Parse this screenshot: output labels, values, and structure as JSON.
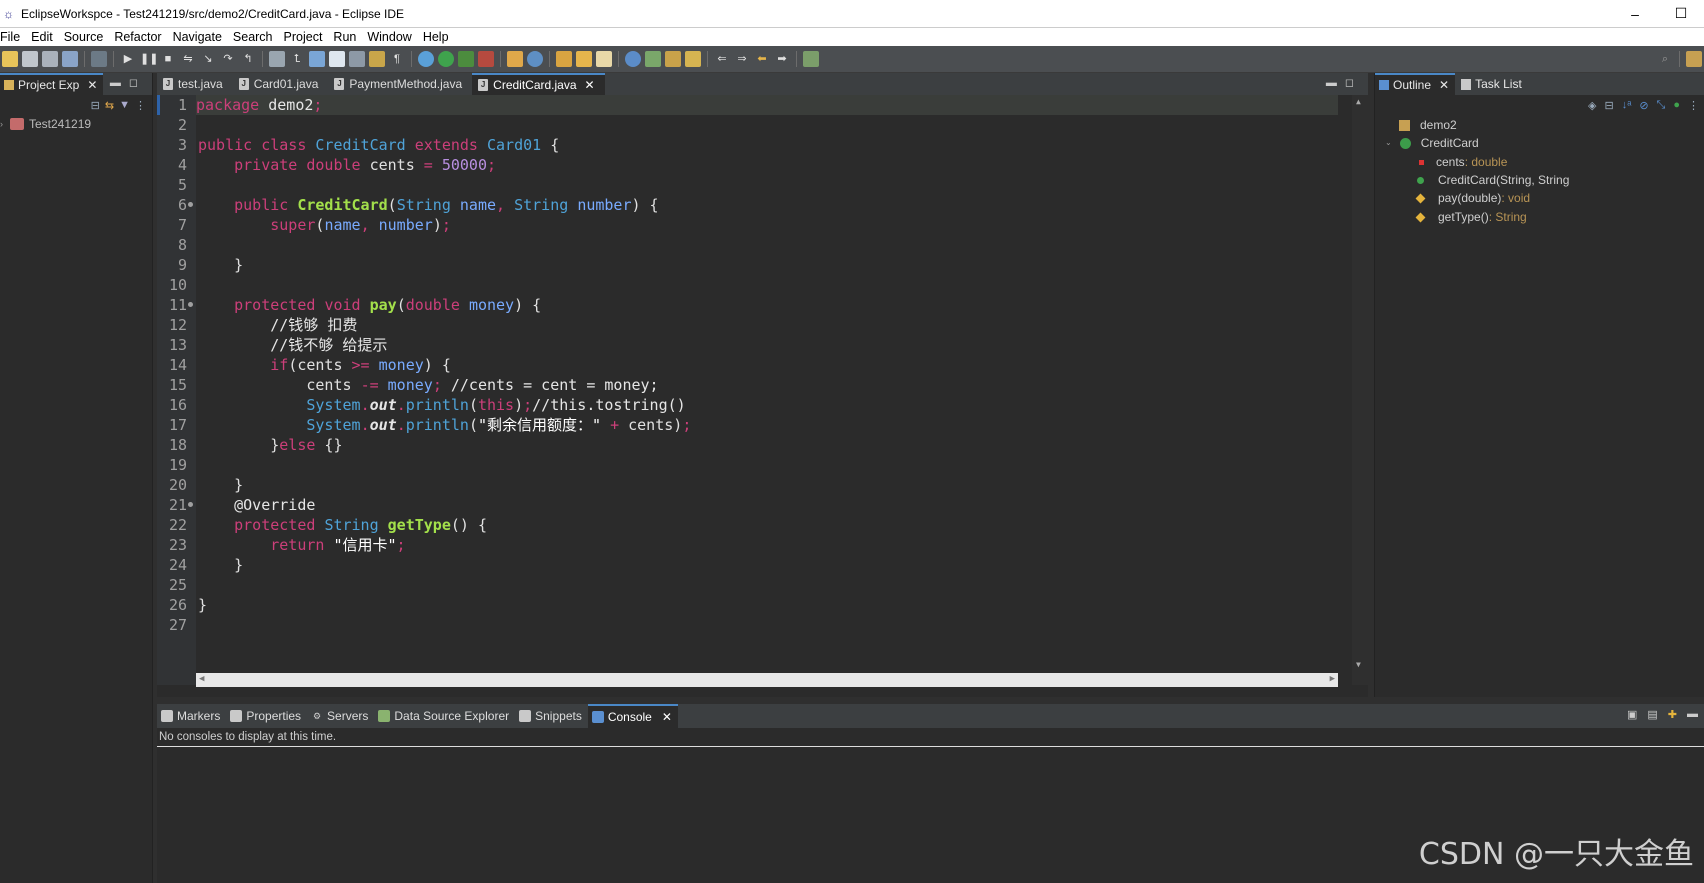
{
  "window": {
    "title": "EclipseWorkspce - Test241219/src/demo2/CreditCard.java - Eclipse IDE",
    "minimize": "–",
    "maximize": "☐"
  },
  "menu": [
    "File",
    "Edit",
    "Source",
    "Refactor",
    "Navigate",
    "Search",
    "Project",
    "Run",
    "Window",
    "Help"
  ],
  "project_explorer": {
    "tab_label": "Project Exp",
    "items": [
      {
        "label": "Test241219"
      }
    ]
  },
  "editor": {
    "tabs": [
      {
        "label": "test.java",
        "active": false
      },
      {
        "label": "Card01.java",
        "active": false
      },
      {
        "label": "PaymentMethod.java",
        "active": false
      },
      {
        "label": "CreditCard.java",
        "active": true
      }
    ],
    "line_numbers": [
      "1",
      "2",
      "3",
      "4",
      "5",
      "6",
      "7",
      "8",
      "9",
      "10",
      "11",
      "12",
      "13",
      "14",
      "15",
      "16",
      "17",
      "18",
      "19",
      "20",
      "21",
      "22",
      "23",
      "24",
      "25",
      "26",
      "27"
    ],
    "lines": [
      "package demo2;",
      "",
      "public class CreditCard extends Card01 {",
      "    private double cents = 50000;",
      "",
      "    public CreditCard(String name, String number) {",
      "        super(name, number);",
      "",
      "    }",
      "",
      "    protected void pay(double money) {",
      "        //钱够 扣费",
      "        //钱不够 给提示",
      "        if(cents >= money) {",
      "            cents -= money; //cents = cent = money;",
      "            System.out.println(this);//this.tostring()",
      "            System.out.println(\"剩余信用额度：\" + cents);",
      "        }else {}",
      "",
      "    }",
      "    @Override",
      "    protected String getType() {",
      "        return \"信用卡\";",
      "    }",
      "",
      "}",
      ""
    ]
  },
  "outline": {
    "tabs": [
      "Outline",
      "Task List"
    ],
    "items": [
      {
        "label": "demo2",
        "type": ""
      },
      {
        "label": "CreditCard",
        "type": ""
      },
      {
        "label": "cents",
        "type": " : double"
      },
      {
        "label": "CreditCard(String, String",
        "type": ""
      },
      {
        "label": "pay(double)",
        "type": " : void"
      },
      {
        "label": "getType()",
        "type": " : String"
      }
    ]
  },
  "bottom": {
    "tabs": [
      {
        "label": "Markers",
        "active": false
      },
      {
        "label": "Properties",
        "active": false
      },
      {
        "label": "Servers",
        "active": false
      },
      {
        "label": "Data Source Explorer",
        "active": false
      },
      {
        "label": "Snippets",
        "active": false
      },
      {
        "label": "Console",
        "active": true
      }
    ],
    "console_message": "No consoles to display at this time."
  },
  "watermark": "CSDN @一只大金鱼",
  "colors": {
    "keyword": "#cc3f7a",
    "class": "#4fa3d8",
    "method": "#a3e04b",
    "number": "#b88fe0",
    "accent": "#4a88c7"
  }
}
